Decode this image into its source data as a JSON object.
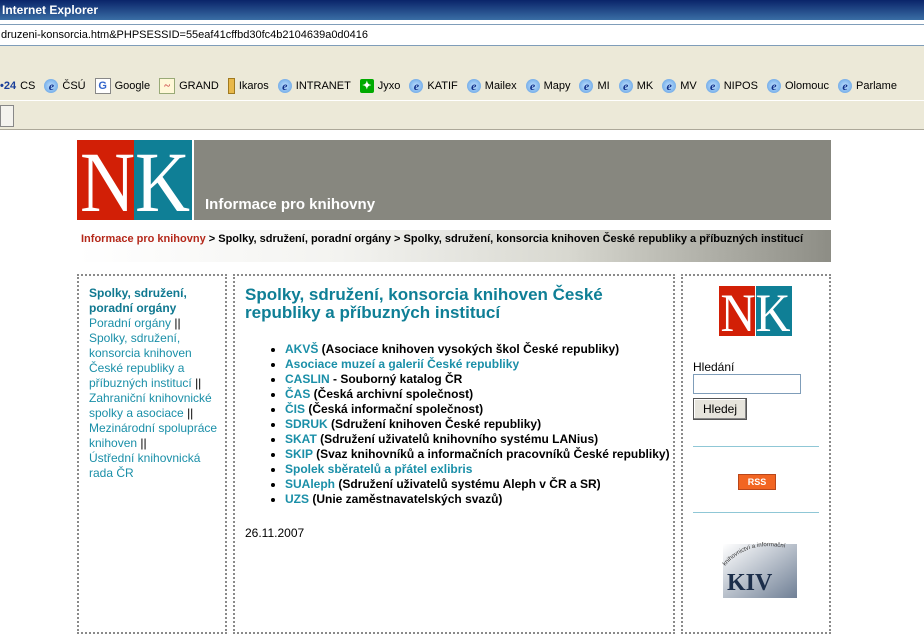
{
  "window": {
    "title": "Internet Explorer"
  },
  "address": {
    "url": "druzeni-konsorcia.htm&PHPSESSID=55eaf41cffbd30fc4b2104639a0d0416"
  },
  "links_bar": [
    {
      "label": "CS",
      "icon": "cs-icon",
      "prefix": "•24"
    },
    {
      "label": "ČSÚ",
      "icon": "ie-icon"
    },
    {
      "label": "Google",
      "icon": "google-icon"
    },
    {
      "label": "GRAND",
      "icon": "chart-icon"
    },
    {
      "label": "Ikaros",
      "icon": "bookmark-icon"
    },
    {
      "label": "INTRANET",
      "icon": "ie-icon"
    },
    {
      "label": "Jyxo",
      "icon": "jyxo-icon"
    },
    {
      "label": "KATIF",
      "icon": "ie-icon"
    },
    {
      "label": "Mailex",
      "icon": "ie-icon"
    },
    {
      "label": "Mapy",
      "icon": "ie-icon"
    },
    {
      "label": "MI",
      "icon": "ie-icon"
    },
    {
      "label": "MK",
      "icon": "ie-icon"
    },
    {
      "label": "MV",
      "icon": "ie-icon"
    },
    {
      "label": "NIPOS",
      "icon": "ie-icon"
    },
    {
      "label": "Olomouc",
      "icon": "ie-icon"
    },
    {
      "label": "Parlame",
      "icon": "ie-icon"
    }
  ],
  "banner": {
    "title": "Informace pro knihovny",
    "logo_text": "NK"
  },
  "breadcrumb": {
    "home": "Informace pro knihovny",
    "rest": " > Spolky, sdružení, poradní orgány > Spolky, sdružení, konsorcia knihoven České republiky a příbuzných institucí"
  },
  "left_nav": {
    "current": "Spolky, sdružení, poradní orgány",
    "items": [
      "Poradní orgány",
      "Spolky, sdružení, konsorcia knihoven České republiky a příbuzných institucí",
      "Zahraniční knihovnické spolky a asociace",
      "Mezinárodní spolupráce knihoven",
      "Ústřední knihovnická rada ČR"
    ],
    "separator": "||"
  },
  "main": {
    "heading": "Spolky, sdružení, konsorcia knihoven České republiky a příbuzných institucí",
    "items": [
      {
        "abbr": "AKVŠ",
        "desc": " (Asociace knihoven vysokých škol České republiky)"
      },
      {
        "abbr": "Asociace muzeí a galerií České republiky",
        "desc": ""
      },
      {
        "abbr": "CASLIN",
        "desc": " - Souborný katalog ČR"
      },
      {
        "abbr": "ČAS",
        "desc": " (Česká archivní společnost)"
      },
      {
        "abbr": "ČIS",
        "desc": " (Česká informační společnost)"
      },
      {
        "abbr": "SDRUK",
        "desc": " (Sdružení knihoven České republiky)"
      },
      {
        "abbr": "SKAT",
        "desc": " (Sdružení uživatelů knihovního systému LANius)"
      },
      {
        "abbr": "SKIP",
        "desc": " (Svaz knihovníků a informačních pracovníků České republiky)"
      },
      {
        "abbr": "Spolek sběratelů a přátel exlibris",
        "desc": ""
      },
      {
        "abbr": "SUAleph",
        "desc": " (Sdružení uživatelů systému Aleph v ČR a SR)"
      },
      {
        "abbr": "UZS",
        "desc": " (Unie zaměstnavatelských svazů)"
      }
    ],
    "date": "26.11.2007"
  },
  "right": {
    "search_label": "Hledání",
    "search_value": "",
    "search_button": "Hledej",
    "rss_label": "RSS",
    "kiv_text": "KIV",
    "kiv_arc": "knihovnictví a informační věda"
  },
  "colors": {
    "nk_red": "#d21f06",
    "nk_teal": "#0f7f96",
    "banner_gray": "#87877f",
    "link": "#1a8fa8"
  }
}
